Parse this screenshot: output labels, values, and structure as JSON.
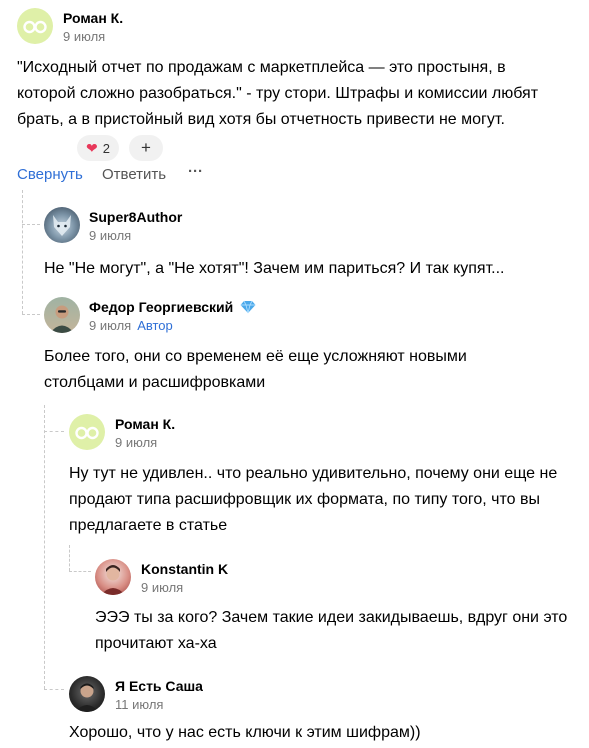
{
  "comments": [
    {
      "author": "Роман К.",
      "date": "9 июля",
      "text": "\"Исходный отчет по продажам с маркетплейса — это простыня, в которой сложно разобраться.\" - тру стори. Штрафы и комиссии любят брать, а в пристойный вид хотя бы отчетность привести не могут."
    },
    {
      "author": "Super8Author",
      "date": "9 июля",
      "text": "Не \"Не могут\", а \"Не хотят\"! Зачем им париться? И так купят..."
    },
    {
      "author": "Федор Георгиевский",
      "date": "9 июля",
      "badge": "Автор",
      "text": "Более того, они со временем её еще усложняют новыми столбцами и расшифровками"
    },
    {
      "author": "Роман К.",
      "date": "9 июля",
      "text": "Ну тут не удивлен.. что реально удивительно, почему они еще не продают типа расшифровщик их формата, по типу того, что вы предлагаете в статье"
    },
    {
      "author": "Konstantin K",
      "date": "9 июля",
      "text": "ЭЭЭ ты за кого? Зачем такие идеи закидываешь, вдруг они это прочитают ха-ха"
    },
    {
      "author": "Я Есть Саша",
      "date": "11 июля",
      "text": "Хорошо, что у нас есть ключи к этим шифрам))"
    }
  ],
  "reactions": {
    "heart_count": "2",
    "add_label": "+"
  },
  "actions": {
    "collapse": "Свернуть",
    "reply": "Ответить",
    "more": "···"
  },
  "colors": {
    "link": "#2f6fd6",
    "heart": "#e8385a",
    "avatar_glasses_bg": "#dff0a8"
  }
}
